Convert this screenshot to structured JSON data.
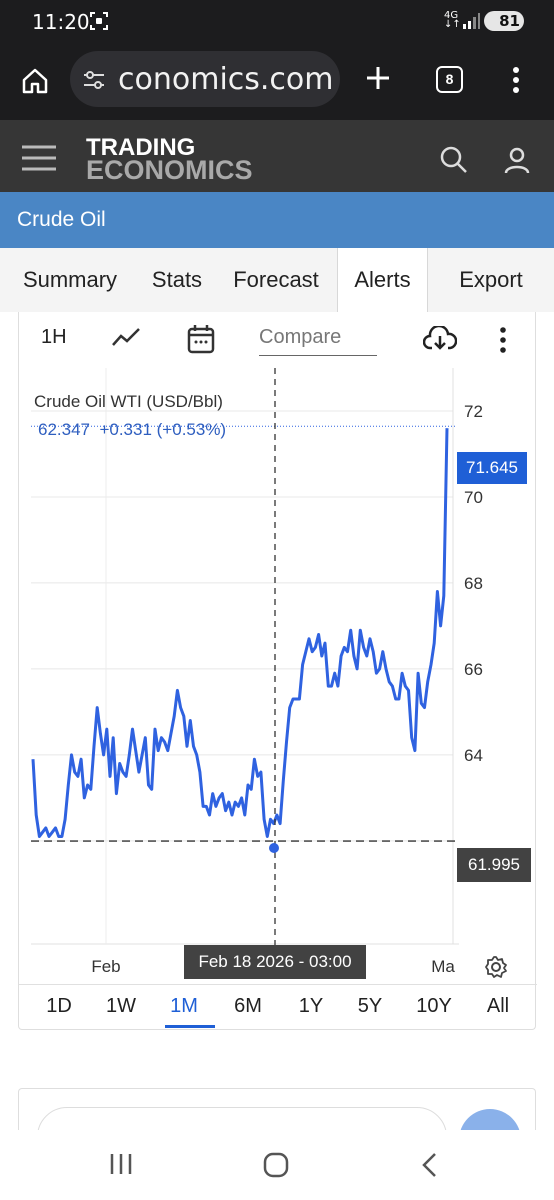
{
  "status": {
    "time": "11:20",
    "network": "4G",
    "battery": "81"
  },
  "browser": {
    "url": "conomics.com",
    "tab_count": "8"
  },
  "site": {
    "logo_line1": "TRADING",
    "logo_line2": "ECONOMICS"
  },
  "page": {
    "title": "Crude Oil"
  },
  "tabs": [
    {
      "label": "Summary"
    },
    {
      "label": "Stats"
    },
    {
      "label": "Forecast"
    },
    {
      "label": "Alerts"
    },
    {
      "label": "Export"
    }
  ],
  "toolbar": {
    "interval": "1H",
    "compare_placeholder": "Compare"
  },
  "legend": {
    "name": "Crude Oil WTI (USD/Bbl)",
    "value": "62.347",
    "change": "+0.331 (+0.53%)"
  },
  "price_tag": "71.645",
  "crosshair": {
    "price": "61.995",
    "date": "Feb 18 2026 - 03:00"
  },
  "ranges": [
    {
      "label": "1D",
      "active": false
    },
    {
      "label": "1W",
      "active": false
    },
    {
      "label": "1M",
      "active": true
    },
    {
      "label": "6M",
      "active": false
    },
    {
      "label": "1Y",
      "active": false
    },
    {
      "label": "5Y",
      "active": false
    },
    {
      "label": "10Y",
      "active": false
    },
    {
      "label": "All",
      "active": false
    }
  ],
  "colors": {
    "accent": "#1f5fd6",
    "title_bar": "#4a86c5",
    "header": "#363636",
    "line": "#2f62e0"
  },
  "chart_data": {
    "type": "line",
    "title": "Crude Oil WTI (USD/Bbl)",
    "x_ticks": [
      "Feb",
      "Ma"
    ],
    "y_ticks": [
      62,
      64,
      66,
      68,
      70,
      72
    ],
    "y_tick_labels": [
      "64",
      "66",
      "68",
      "70",
      "72"
    ],
    "ylim": [
      59.6,
      73.0
    ],
    "grid": true,
    "series": [
      {
        "values": [
          63.9,
          62.6,
          62.1,
          62.2,
          62.3,
          62.1,
          62.2,
          62.3,
          62.1,
          62.1,
          62.5,
          63.3,
          64.0,
          63.6,
          63.5,
          63.9,
          63.0,
          63.3,
          63.2,
          64.2,
          65.1,
          64.5,
          64.0,
          64.6,
          63.5,
          64.4,
          63.1,
          63.8,
          63.6,
          63.5,
          64.0,
          64.6,
          64.1,
          63.6,
          64.0,
          64.4,
          63.3,
          63.2,
          64.6,
          64.1,
          64.4,
          64.3,
          64.1,
          64.5,
          64.9,
          65.5,
          65.1,
          64.9,
          64.2,
          64.8,
          64.2,
          64.0,
          63.6,
          62.8,
          62.8,
          62.6,
          63.1,
          62.8,
          63.0,
          63.1,
          62.7,
          62.9,
          62.6,
          62.9,
          62.8,
          63.0,
          62.6,
          63.3,
          63.2,
          63.9,
          63.5,
          63.6,
          62.5,
          62.1,
          62.5,
          62.4,
          62.6,
          62.4,
          63.4,
          64.3,
          65.1,
          65.3,
          65.3,
          65.3,
          66.1,
          66.4,
          66.7,
          66.4,
          66.5,
          66.8,
          66.3,
          66.6,
          65.6,
          65.6,
          65.9,
          65.6,
          66.3,
          66.5,
          66.4,
          66.9,
          66.3,
          66.0,
          66.9,
          66.5,
          66.3,
          66.7,
          66.4,
          65.9,
          66.0,
          66.4,
          66.0,
          65.7,
          65.6,
          65.3,
          65.3,
          65.9,
          65.6,
          65.5,
          64.4,
          64.1,
          65.9,
          65.2,
          65.1,
          65.7,
          66.1,
          66.6,
          67.8,
          67.0,
          67.7,
          71.6
        ]
      }
    ],
    "crosshair": {
      "x_label": "Feb 18 2026 - 03:00",
      "y": 61.995
    },
    "last_value": 71.645
  }
}
